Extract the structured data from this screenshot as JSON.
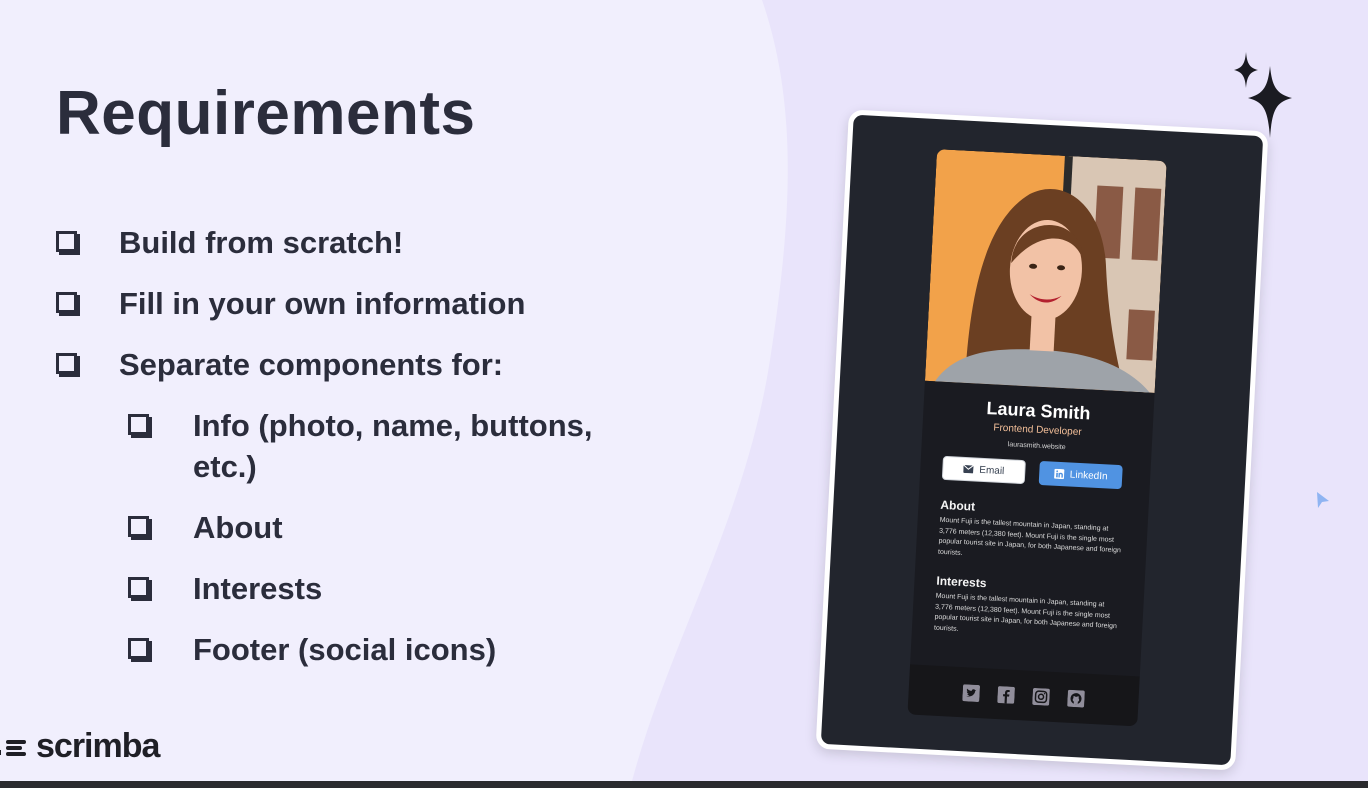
{
  "slide": {
    "title": "Requirements",
    "items": [
      {
        "text": "Build from scratch!"
      },
      {
        "text": "Fill in your own information"
      },
      {
        "text": "Separate components for:"
      },
      {
        "text": "Info (photo, name, buttons,",
        "text2": "etc.)"
      },
      {
        "text": "About"
      },
      {
        "text": "Interests"
      },
      {
        "text": "Footer (social icons)"
      }
    ],
    "logo": "scrimba",
    "colors": {
      "background": "#e9e4fb",
      "text": "#2b2d3c"
    }
  },
  "card": {
    "name": "Laura Smith",
    "role": "Frontend Developer",
    "website": "laurasmith.website",
    "email_label": "Email",
    "linkedin_label": "LinkedIn",
    "about_title": "About",
    "about_text": "Mount Fuji is the tallest mountain in Japan, standing at 3,776 meters (12,380 feet). Mount Fuji is the single most popular tourist site in Japan, for both Japanese and foreign tourists.",
    "interests_title": "Interests",
    "interests_text": "Mount Fuji is the tallest mountain in Japan, standing at 3,776 meters (12,380 feet). Mount Fuji is the single most popular tourist site in Japan, for both Japanese and foreign tourists.",
    "social_icons": [
      "twitter-icon",
      "facebook-icon",
      "instagram-icon",
      "github-icon"
    ],
    "colors": {
      "card_bg": "#1a1b21",
      "role": "#f3bf99",
      "linkedin": "#5093e2"
    }
  }
}
